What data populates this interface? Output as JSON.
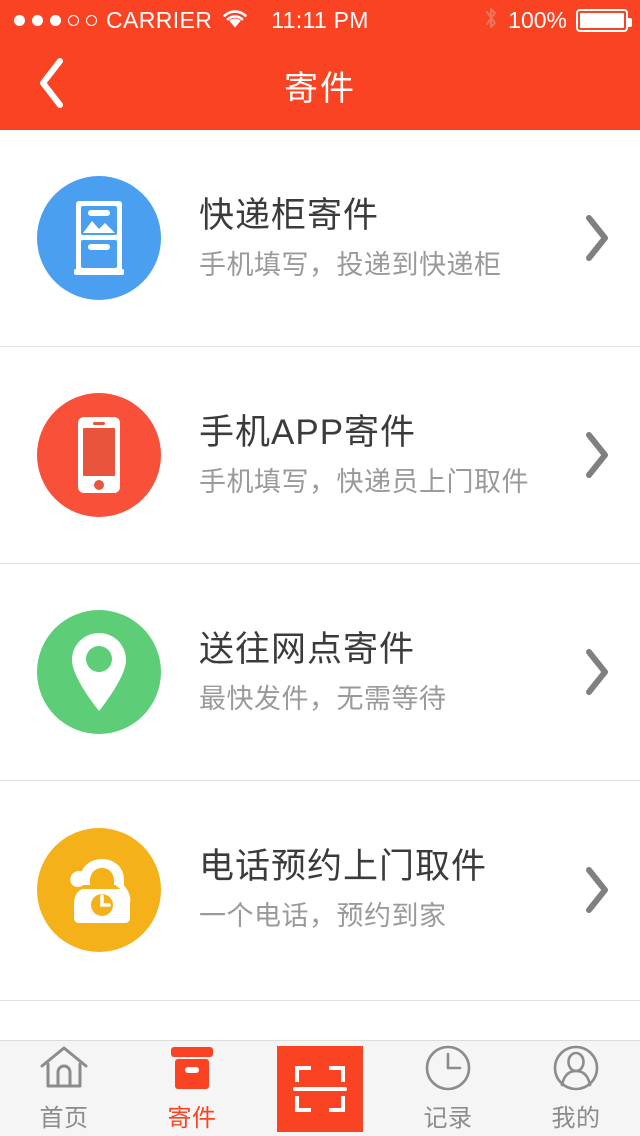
{
  "theme": {
    "brand_red": "#fa4323",
    "text_dark": "#3b3b3b",
    "text_muted": "#9a9a9a",
    "tab_inactive": "#8c8c8c",
    "tabbar_bg": "#f5f5f5",
    "separator": "#e2e2e2"
  },
  "statusbar": {
    "signal_dots_filled": 3,
    "signal_dots_total": 5,
    "carrier": "CARRIER",
    "wifi_icon": "wifi-icon",
    "time": "11:11 PM",
    "bluetooth_icon": "bluetooth-icon",
    "battery_percent": "100%",
    "battery_icon": "battery-full-icon"
  },
  "navbar": {
    "back_icon": "chevron-left-icon",
    "title": "寄件"
  },
  "list": {
    "items": [
      {
        "icon_name": "parcel-locker-icon",
        "icon_bg": "#4a9ff0",
        "title": "快递柜寄件",
        "subtitle": "手机填写，投递到快递柜",
        "chevron_icon": "chevron-right-icon"
      },
      {
        "icon_name": "smartphone-icon",
        "icon_bg": "#f9503a",
        "title": "手机APP寄件",
        "subtitle": "手机填写，快递员上门取件",
        "chevron_icon": "chevron-right-icon"
      },
      {
        "icon_name": "map-pin-icon",
        "icon_bg": "#5ecd78",
        "title": "送往网点寄件",
        "subtitle": "最快发件，无需等待",
        "chevron_icon": "chevron-right-icon"
      },
      {
        "icon_name": "telephone-icon",
        "icon_bg": "#f5b119",
        "title": "电话预约上门取件",
        "subtitle": "一个电话，预约到家",
        "chevron_icon": "chevron-right-icon"
      }
    ]
  },
  "tabbar": {
    "items": [
      {
        "icon_name": "home-icon",
        "label": "首页",
        "active": false
      },
      {
        "icon_name": "box-icon",
        "label": "寄件",
        "active": true
      },
      {
        "icon_name": "scan-icon",
        "label": "",
        "active": false
      },
      {
        "icon_name": "clock-icon",
        "label": "记录",
        "active": false
      },
      {
        "icon_name": "person-icon",
        "label": "我的",
        "active": false
      }
    ]
  }
}
